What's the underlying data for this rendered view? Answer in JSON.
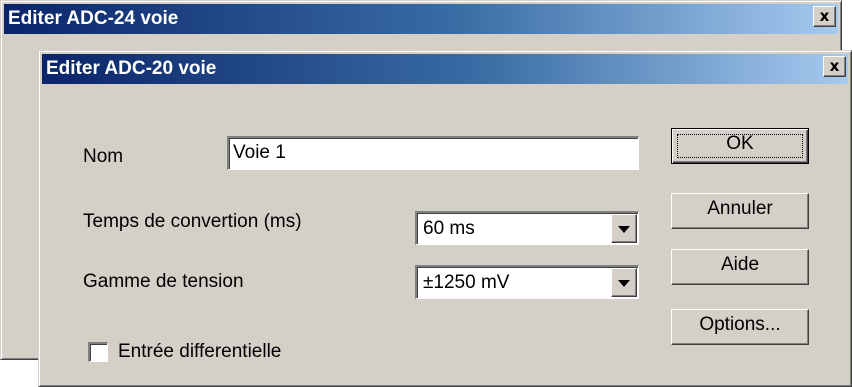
{
  "back_window": {
    "title": "Editer ADC-24 voie",
    "close_label": "x"
  },
  "front_window": {
    "title": "Editer ADC-20 voie",
    "close_label": "x"
  },
  "form": {
    "name_label": "Nom",
    "name_value": "Voie 1",
    "conversion_label": "Temps de convertion (ms)",
    "conversion_value": "60 ms",
    "range_label": "Gamme de tension",
    "range_value": "±1250 mV",
    "differential_label": "Entrée differentielle",
    "differential_checked": false
  },
  "buttons": {
    "ok": "OK",
    "cancel": "Annuler",
    "help": "Aide",
    "options": "Options..."
  }
}
